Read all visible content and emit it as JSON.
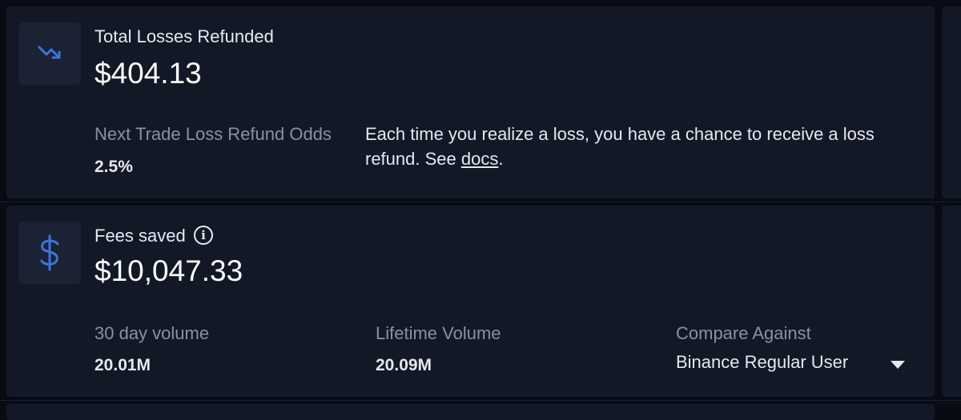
{
  "losses_card": {
    "title": "Total Losses Refunded",
    "amount": "$404.13",
    "icon": "trending-down-icon",
    "odds_label": "Next Trade Loss Refund Odds",
    "odds_value": "2.5%",
    "description_text": "Each time you realize a loss, you have a chance to receive a loss refund. See ",
    "docs_link": "docs",
    "description_end": "."
  },
  "fees_card": {
    "title": "Fees saved",
    "amount": "$10,047.33",
    "icon": "dollar-icon",
    "info_icon": "info-icon",
    "stats": [
      {
        "label": "30 day volume",
        "value": "20.01M"
      },
      {
        "label": "Lifetime Volume",
        "value": "20.09M"
      }
    ],
    "compare_label": "Compare Against",
    "compare_value": "Binance Regular User"
  },
  "colors": {
    "background": "#080b14",
    "card": "#131827",
    "icon_box": "#1a2233",
    "accent": "#3a74e0",
    "muted_text": "#8b909c"
  }
}
